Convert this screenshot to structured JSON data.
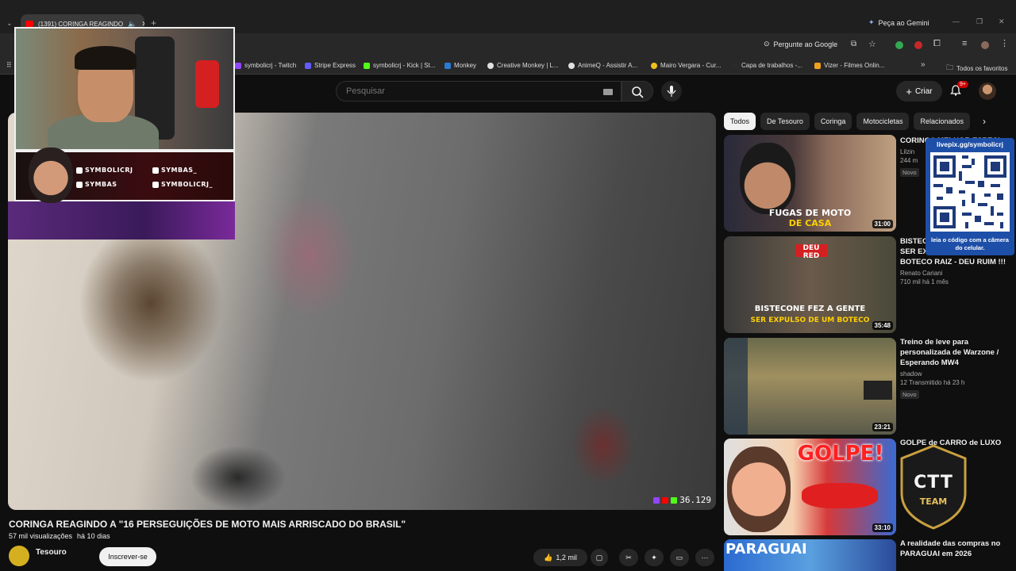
{
  "browser": {
    "tab_title": "(1391) CORINGA REAGINDO",
    "gemini_label": "Peça ao Gemini",
    "ask_google_label": "Pergunte ao Google",
    "bookmarks": [
      "symbolicrj - Twitch",
      "Stripe Express",
      "symbolicrj - Kick | St...",
      "Monkey",
      "Creative Monkey | L...",
      "AnimeQ - Assistir A...",
      "Mairo Vergara - Cur...",
      "Capa de trabalhos -...",
      "Vizer - Filmes Onlin..."
    ],
    "bookmark_colors": [
      "#9146ff",
      "#635bff",
      "#53fc18",
      "#2a7ad5",
      "#e0e0e0",
      "#e0e0e0",
      "#f0c020",
      "#2a2a2a",
      "#f0a020"
    ],
    "all_bookmarks_label": "Todos os favoritos"
  },
  "header": {
    "search_placeholder": "Pesquisar",
    "create_label": "Criar",
    "notif_badge": "9+"
  },
  "overlay": {
    "socials": [
      "SYMBOLICRJ",
      "SYMBAS_",
      "SYMBAS",
      "SYMBOLICRJ_"
    ],
    "viewer_count": "36.129"
  },
  "video": {
    "title": "CORINGA REAGINDO A \"16 PERSEGUIÇÕES DE MOTO MAIS ARRISCADO DO BRASIL\"",
    "views": "57 mil visualizações",
    "age": "há 10 dias",
    "channel": "Tesouro",
    "subscribe_label": "Inscrever-se",
    "likes": "1,2 mil"
  },
  "chips": [
    "Todos",
    "De Tesouro",
    "Coringa",
    "Motocicletas",
    "Relacionados"
  ],
  "recommendations": [
    {
      "title": "CORINGA MELHOR ESPECI...",
      "channel": "Lilzin",
      "meta": "244 m",
      "badge": "Novo",
      "duration": "31:00",
      "thumb_text_1": "FUGAS DE MOTO",
      "thumb_text_2": "DE CASA"
    },
    {
      "title": "BISTECONE FEZ A GENTE SER EXPULSO DE UM BOTECO RAIZ - DEU RUIM !!!",
      "channel": "Renato Cariani",
      "meta": "710 mil  há 1 mês",
      "badge": "",
      "duration": "35:48",
      "thumb_text_1": "BISTECONE FEZ A GENTE",
      "thumb_text_2": "SER EXPULSO DE UM BOTECO",
      "thumb_tag": "DEU RED"
    },
    {
      "title": "Treino de leve para personalizada de Warzone / Esperando MW4",
      "channel": "shadow",
      "meta": "12  Transmitido há 23 h",
      "badge": "Novo",
      "duration": "23:21"
    },
    {
      "title": "GOLPE de CARRO de LUXO",
      "channel": "",
      "meta": "",
      "badge": "",
      "duration": "33:10",
      "thumb_text_1": "GOLPE!"
    },
    {
      "title": "A realidade das compras no PARAGUAI em 2026",
      "channel": "",
      "meta": "",
      "badge": "",
      "duration": "",
      "thumb_text_1": "PARAGUAI"
    }
  ],
  "qr": {
    "top": "livepix.gg/symbolicrj",
    "bottom": "leia o código com a câmera do celular."
  },
  "ctt": {
    "line1": "CTT",
    "line2": "TEAM"
  }
}
